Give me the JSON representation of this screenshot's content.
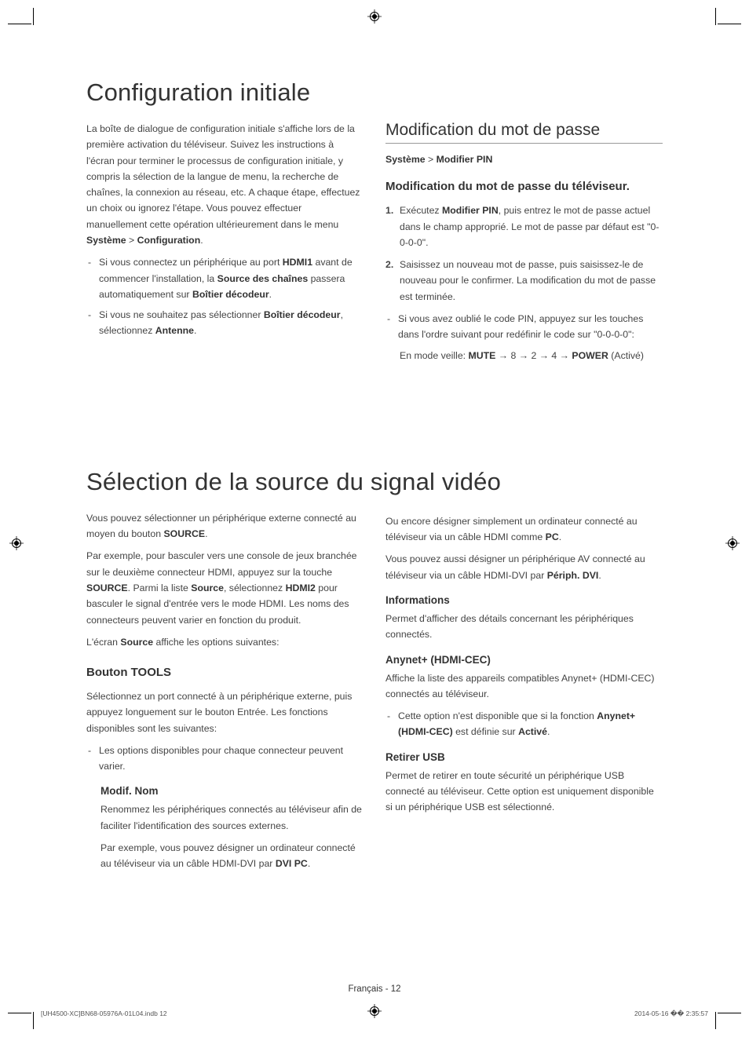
{
  "section1": {
    "title": "Configuration initiale",
    "left": {
      "intro_part1": "La boîte de dialogue de configuration initiale s'affiche lors de la première activation du téléviseur. Suivez les instructions à l'écran pour terminer le processus de configuration initiale, y compris la sélection de la langue de menu, la recherche de chaînes, la connexion au réseau, etc. A chaque étape, effectuez un choix ou ignorez l'étape. Vous pouvez effectuer manuellement cette opération ultérieurement dans le menu ",
      "intro_bold1": "Système",
      "intro_gt": " > ",
      "intro_bold2": "Configuration",
      "intro_period": ".",
      "bullets": [
        {
          "pre": "Si vous connectez un périphérique au port ",
          "b1": "HDMI1",
          "mid1": " avant de commencer l'installation, la ",
          "b2": "Source des chaînes",
          "mid2": " passera automatiquement sur ",
          "b3": "Boîtier décodeur",
          "post": "."
        },
        {
          "pre": "Si vous ne souhaitez pas sélectionner ",
          "b1": "Boîtier décodeur",
          "mid1": ", sélectionnez ",
          "b2": "Antenne",
          "post": "."
        }
      ]
    },
    "right": {
      "heading": "Modification du mot de passe",
      "breadcrumb_b1": "Système",
      "breadcrumb_gt": " > ",
      "breadcrumb_b2": "Modifier PIN",
      "subheading": "Modification du mot de passe du téléviseur.",
      "steps": [
        {
          "n": "1.",
          "pre": "Exécutez ",
          "b": "Modifier PIN",
          "post": ", puis entrez le mot de passe actuel dans le champ approprié. Le mot de passe par défaut est \"0-0-0-0\"."
        },
        {
          "n": "2.",
          "pre": "",
          "b": "",
          "post": "Saisissez un nouveau mot de passe, puis saisissez-le de nouveau pour le confirmer. La modification du mot de passe est terminée."
        }
      ],
      "dash": "Si vous avez oublié le code PIN, appuyez sur les touches dans l'ordre suivant pour redéfinir le code sur \"0-0-0-0\":",
      "standby_pre": "En mode veille: ",
      "standby_b1": "MUTE",
      "standby_seq": " → 8 → 2 → 4 → ",
      "standby_b2": "POWER",
      "standby_post": " (Activé)"
    }
  },
  "section2": {
    "title": "Sélection de la source du signal vidéo",
    "left": {
      "p1_pre": "Vous pouvez sélectionner un périphérique externe connecté au moyen du bouton ",
      "p1_b": "SOURCE",
      "p1_post": ".",
      "p2_pre": "Par exemple, pour basculer vers une console de jeux branchée sur le deuxième connecteur HDMI, appuyez sur la touche ",
      "p2_b1": "SOURCE",
      "p2_mid1": ". Parmi la liste ",
      "p2_b2": "Source",
      "p2_mid2": ", sélectionnez ",
      "p2_b3": "HDMI2",
      "p2_post": " pour basculer le signal d'entrée vers le mode HDMI. Les noms des connecteurs peuvent varier en fonction du produit.",
      "p3_pre": "L'écran ",
      "p3_b": "Source",
      "p3_post": " affiche les options suivantes:",
      "h3": "Bouton TOOLS",
      "p4": "Sélectionnez un port connecté à un périphérique externe, puis appuyez longuement sur le bouton Entrée. Les fonctions disponibles sont les suivantes:",
      "dash": "Les options disponibles pour chaque connecteur peuvent varier.",
      "h4": "Modif. Nom",
      "p5": "Renommez les périphériques connectés au téléviseur afin de faciliter l'identification des sources externes.",
      "p6_pre": "Par exemple, vous pouvez désigner un ordinateur connecté au téléviseur via un câble HDMI-DVI par ",
      "p6_b": "DVI PC",
      "p6_post": "."
    },
    "right": {
      "p1_pre": "Ou encore désigner simplement un ordinateur connecté au téléviseur via un câble HDMI comme ",
      "p1_b": "PC",
      "p1_post": ".",
      "p2_pre": "Vous pouvez aussi désigner un périphérique AV connecté au téléviseur via un câble HDMI-DVI par ",
      "p2_b": "Périph. DVI",
      "p2_post": ".",
      "h4a": "Informations",
      "p3": "Permet d'afficher des détails concernant les périphériques connectés.",
      "h4b": "Anynet+ (HDMI-CEC)",
      "p4": "Affiche la liste des appareils compatibles Anynet+ (HDMI-CEC) connectés au téléviseur.",
      "dash_pre": "Cette option n'est disponible que si la fonction ",
      "dash_b1": "Anynet+ (HDMI-CEC)",
      "dash_mid": " est définie sur ",
      "dash_b2": "Activé",
      "dash_post": ".",
      "h4c": "Retirer USB",
      "p5": "Permet de retirer en toute sécurité un périphérique USB connecté au téléviseur. Cette option est uniquement disponible si un périphérique USB est sélectionné."
    }
  },
  "footer": "Français - 12",
  "imprint_left": "[UH4500-XC]BN68-05976A-01L04.indb   12",
  "imprint_right": "2014-05-16   �� 2:35:57"
}
